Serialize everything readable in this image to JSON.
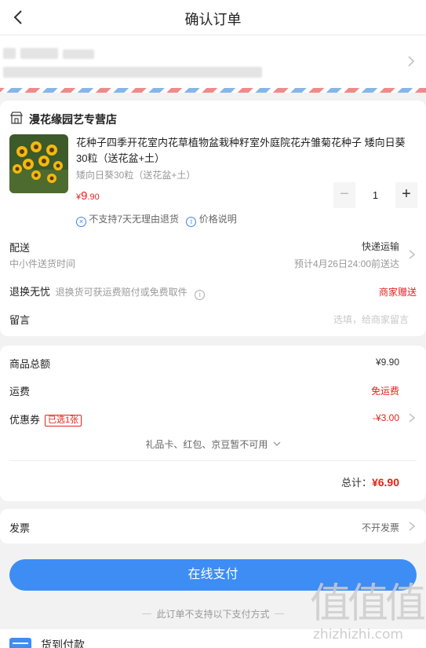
{
  "header": {
    "title": "确认订单"
  },
  "shop": {
    "name": "漫花缘园艺专营店"
  },
  "product": {
    "title": "花种子四季开花室内花草植物盆栽种籽室外庭院花卉雏菊花种子 矮向日葵30粒（送花盆+土）",
    "spec": "矮向日葵30粒（送花盆+土）",
    "price_symbol": "¥",
    "price_int": "9",
    "price_dec": ".90",
    "quantity": "1",
    "minus": "−",
    "plus": "+",
    "note_return": "不支持7天无理由退货",
    "note_price": "价格说明"
  },
  "delivery": {
    "label": "配送",
    "method": "快递运输",
    "sub": "中小件送货时间",
    "eta": "预计4月26日24:00前送达"
  },
  "worry_free": {
    "label": "退换无忧",
    "desc": "退换货可获运费赔付或免费取件",
    "badge": "商家赠送"
  },
  "message": {
    "label": "留言",
    "placeholder": "选填，给商家留言"
  },
  "summary": {
    "goods_total_label": "商品总额",
    "goods_total": "¥9.90",
    "shipping_label": "运费",
    "shipping": "免运费",
    "coupon_label": "优惠券",
    "coupon_tag": "已选1张",
    "coupon_value": "-¥3.00",
    "gifts_note": "礼品卡、红包、京豆暂不可用",
    "total_label": "总计：",
    "total": "¥6.90"
  },
  "invoice": {
    "label": "发票",
    "value": "不开发票"
  },
  "payment": {
    "button": "在线支付",
    "not_supported": "此订单不支持以下支付方式",
    "cod_label": "货到付款"
  },
  "watermark": {
    "glyphs": "值值值",
    "text": "zhizhizhi.com"
  },
  "colors": {
    "accent": "#3d8df5",
    "price_red": "#e2231a"
  }
}
